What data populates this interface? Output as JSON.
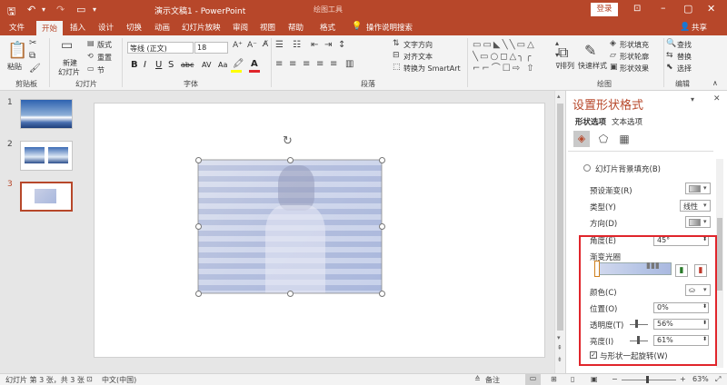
{
  "titlebar": {
    "title": "演示文稿1 - PowerPoint",
    "context_tool": "绘图工具",
    "login_label": "登录",
    "window_controls": [
      "restore-ribbon-icon",
      "minimize-icon",
      "maximize-icon",
      "close-icon"
    ]
  },
  "tabs": [
    {
      "label": "文件"
    },
    {
      "label": "开始"
    },
    {
      "label": "插入"
    },
    {
      "label": "设计"
    },
    {
      "label": "切换"
    },
    {
      "label": "动画"
    },
    {
      "label": "幻灯片放映"
    },
    {
      "label": "审阅"
    },
    {
      "label": "视图"
    },
    {
      "label": "帮助"
    },
    {
      "label": "格式"
    }
  ],
  "tell_me": "操作说明搜索",
  "share_label": "共享",
  "ribbon": {
    "clipboard": {
      "paste": "粘贴",
      "group": "剪贴板"
    },
    "slides": {
      "new_slide": "新建",
      "new_slide2": "幻灯片",
      "layout": "版式",
      "reset": "重置",
      "section": "节",
      "group": "幻灯片"
    },
    "font": {
      "font_name": "等线 (正文)",
      "font_size": "18",
      "bold": "B",
      "italic": "I",
      "underline": "U",
      "strike": "S",
      "shadow": "abc",
      "spacing": "AV",
      "case": "Aa",
      "group": "字体"
    },
    "paragraph": {
      "text_direction": "文字方向",
      "align_text": "对齐文本",
      "smartart": "转换为 SmartArt",
      "group": "段落"
    },
    "drawing": {
      "arrange": "排列",
      "quick_styles": "快速样式",
      "fill": "形状填充",
      "outline": "形状轮廓",
      "effects": "形状效果",
      "group": "绘图"
    },
    "editing": {
      "find": "查找",
      "replace": "替换",
      "select": "选择",
      "group": "编辑"
    }
  },
  "thumbnails": [
    {
      "number": "1"
    },
    {
      "number": "2"
    },
    {
      "number": "3"
    }
  ],
  "pane": {
    "title": "设置形状格式",
    "tab_shape": "形状选项",
    "tab_text": "文本选项",
    "slide_bg_fill": "幻灯片背景填充(B)",
    "preset": "预设渐变(R)",
    "type": "类型(Y)",
    "type_value": "线性",
    "direction": "方向(D)",
    "angle": "角度(E)",
    "angle_value": "45°",
    "stops": "渐变光圈",
    "color": "颜色(C)",
    "position": "位置(O)",
    "position_value": "0%",
    "transparency": "透明度(T)",
    "transparency_value": "56%",
    "transparency_level": 0.56,
    "brightness": "亮度(I)",
    "brightness_value": "61%",
    "brightness_level": 0.61,
    "rotate_with_shape": "与形状一起旋转(W)"
  },
  "status": {
    "slide_info": "幻灯片 第 3 张，共 3 张",
    "language": "中文(中国)",
    "notes": "备注",
    "zoom": "63%"
  },
  "colors": {
    "accent": "#b7472a",
    "highlight_box": "#e0252b"
  }
}
